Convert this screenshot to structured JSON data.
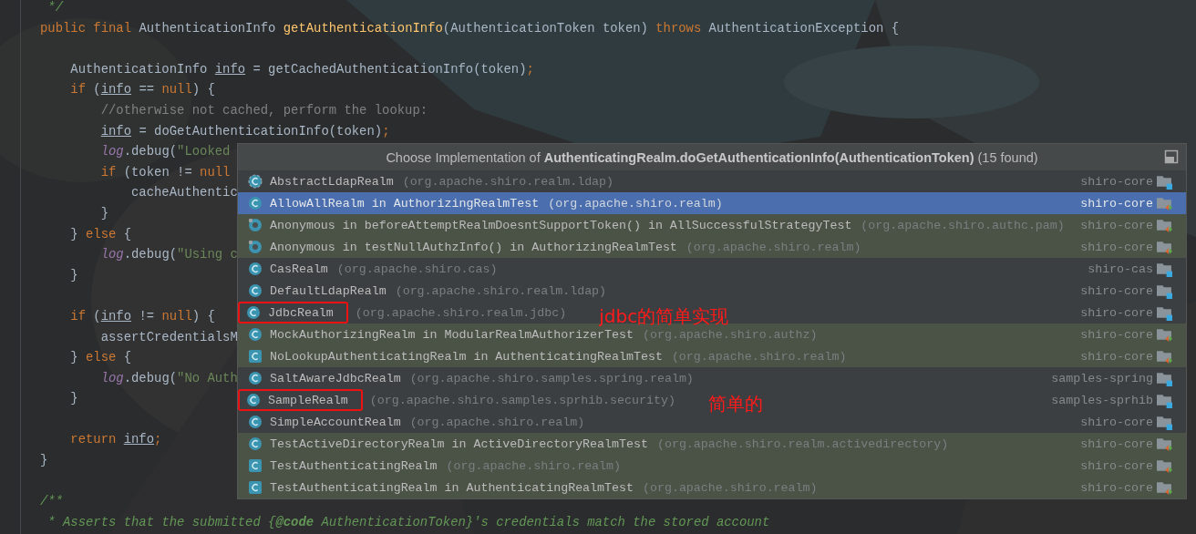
{
  "editor": {
    "lines": [
      {
        "segments": [
          {
            "kind": "doc",
            "text": " */"
          }
        ]
      },
      {
        "segments": [
          {
            "kind": "kw",
            "text": "public final "
          },
          {
            "kind": "plain",
            "text": "AuthenticationInfo "
          },
          {
            "kind": "fn",
            "text": "getAuthenticationInfo"
          },
          {
            "kind": "plain",
            "text": "(AuthenticationToken token) "
          },
          {
            "kind": "kw",
            "text": "throws "
          },
          {
            "kind": "plain",
            "text": "AuthenticationException {"
          }
        ]
      },
      {
        "kind": "blank"
      },
      {
        "segments": [
          {
            "kind": "plain",
            "text": "    AuthenticationInfo "
          },
          {
            "kind": "var",
            "text": "info"
          },
          {
            "kind": "plain",
            "text": " = getCachedAuthenticationInfo(token)"
          },
          {
            "kind": "kw",
            "text": ";"
          }
        ]
      },
      {
        "segments": [
          {
            "kind": "kw",
            "text": "    if "
          },
          {
            "kind": "plain",
            "text": "("
          },
          {
            "kind": "var",
            "text": "info"
          },
          {
            "kind": "plain",
            "text": " == "
          },
          {
            "kind": "kw",
            "text": "null"
          },
          {
            "kind": "plain",
            "text": ") {"
          }
        ]
      },
      {
        "segments": [
          {
            "kind": "comment",
            "text": "        //otherwise not cached, perform the lookup:"
          }
        ]
      },
      {
        "segments": [
          {
            "kind": "var",
            "text": "        info"
          },
          {
            "kind": "plain",
            "text": " = doGetAuthenticationInfo(token)"
          },
          {
            "kind": "kw",
            "text": ";"
          }
        ]
      },
      {
        "segments": [
          {
            "kind": "field",
            "text": "        log"
          },
          {
            "kind": "plain",
            "text": ".debug("
          },
          {
            "kind": "str",
            "text": "\"Looked"
          }
        ]
      },
      {
        "segments": [
          {
            "kind": "kw",
            "text": "        if "
          },
          {
            "kind": "plain",
            "text": "(token != "
          },
          {
            "kind": "kw",
            "text": "null"
          }
        ]
      },
      {
        "segments": [
          {
            "kind": "plain",
            "text": "            cacheAuthentic"
          }
        ]
      },
      {
        "segments": [
          {
            "kind": "plain",
            "text": "        }"
          }
        ]
      },
      {
        "segments": [
          {
            "kind": "plain",
            "text": "    } "
          },
          {
            "kind": "kw",
            "text": "else"
          },
          {
            "kind": "plain",
            "text": " {"
          }
        ]
      },
      {
        "segments": [
          {
            "kind": "field",
            "text": "        log"
          },
          {
            "kind": "plain",
            "text": ".debug("
          },
          {
            "kind": "str",
            "text": "\"Using c"
          }
        ]
      },
      {
        "segments": [
          {
            "kind": "plain",
            "text": "    }"
          }
        ]
      },
      {
        "kind": "blank"
      },
      {
        "segments": [
          {
            "kind": "kw",
            "text": "    if "
          },
          {
            "kind": "plain",
            "text": "("
          },
          {
            "kind": "var",
            "text": "info"
          },
          {
            "kind": "plain",
            "text": " != "
          },
          {
            "kind": "kw",
            "text": "null"
          },
          {
            "kind": "plain",
            "text": ") {"
          }
        ]
      },
      {
        "segments": [
          {
            "kind": "plain",
            "text": "        assertCredentialsM"
          }
        ]
      },
      {
        "segments": [
          {
            "kind": "plain",
            "text": "    } "
          },
          {
            "kind": "kw",
            "text": "else"
          },
          {
            "kind": "plain",
            "text": " {"
          }
        ]
      },
      {
        "segments": [
          {
            "kind": "field",
            "text": "        log"
          },
          {
            "kind": "plain",
            "text": ".debug("
          },
          {
            "kind": "str",
            "text": "\"No Auth"
          }
        ]
      },
      {
        "segments": [
          {
            "kind": "plain",
            "text": "    }"
          }
        ]
      },
      {
        "kind": "blank"
      },
      {
        "segments": [
          {
            "kind": "kw",
            "text": "    return "
          },
          {
            "kind": "var",
            "text": "info"
          },
          {
            "kind": "kw",
            "text": ";"
          }
        ]
      },
      {
        "segments": [
          {
            "kind": "plain",
            "text": "}"
          }
        ]
      },
      {
        "kind": "blank"
      },
      {
        "segments": [
          {
            "kind": "doc",
            "text": "/**"
          }
        ]
      },
      {
        "segments": [
          {
            "kind": "doc",
            "text": " * Asserts that the submitted {**@code** AuthenticationToken}'s credentials match the stored account"
          }
        ]
      }
    ]
  },
  "popup": {
    "title": "Choose Implementation of **AuthenticatingRealm.doGetAuthenticationInfo(AuthenticationToken)** (15 found)",
    "rows": [
      {
        "kind": "abstract",
        "name": "AbstractLdapRealm",
        "package": "(org.apache.shiro.realm.ldap)",
        "module": "shiro-core",
        "test": false,
        "selected": false
      },
      {
        "kind": "class",
        "name": "AllowAllRealm in AuthorizingRealmTest",
        "package": "(org.apache.shiro.realm)",
        "module": "shiro-core",
        "test": true,
        "selected": true
      },
      {
        "kind": "anonymous",
        "name": "Anonymous in beforeAttemptRealmDoesntSupportToken() in AllSuccessfulStrategyTest",
        "package": "(org.apache.shiro.authc.pam)",
        "module": "shiro-core",
        "test": true,
        "selected": false
      },
      {
        "kind": "anonymous",
        "name": "Anonymous in testNullAuthzInfo() in AuthorizingRealmTest",
        "package": "(org.apache.shiro.realm)",
        "module": "shiro-core",
        "test": true,
        "selected": false
      },
      {
        "kind": "class",
        "name": "CasRealm",
        "package": "(org.apache.shiro.cas)",
        "module": "shiro-cas",
        "test": false,
        "selected": false
      },
      {
        "kind": "class",
        "name": "DefaultLdapRealm",
        "package": "(org.apache.shiro.realm.ldap)",
        "module": "shiro-core",
        "test": false,
        "selected": false
      },
      {
        "kind": "class",
        "name": "JdbcRealm",
        "package": "(org.apache.shiro.realm.jdbc)",
        "module": "shiro-core",
        "test": false,
        "selected": false,
        "circled": true,
        "note": "jdbc的简单实现"
      },
      {
        "kind": "class",
        "name": "MockAuthorizingRealm in ModularRealmAuthorizerTest",
        "package": "(org.apache.shiro.authz)",
        "module": "shiro-core",
        "test": true,
        "selected": false
      },
      {
        "kind": "square",
        "name": "NoLookupAuthenticatingRealm in AuthenticatingRealmTest",
        "package": "(org.apache.shiro.realm)",
        "module": "shiro-core",
        "test": true,
        "selected": false
      },
      {
        "kind": "class",
        "name": "SaltAwareJdbcRealm",
        "package": "(org.apache.shiro.samples.spring.realm)",
        "module": "samples-spring",
        "test": false,
        "selected": false
      },
      {
        "kind": "class",
        "name": "SampleRealm",
        "package": "(org.apache.shiro.samples.sprhib.security)",
        "module": "samples-sprhib",
        "test": false,
        "selected": false,
        "circled": true,
        "note": "简单的"
      },
      {
        "kind": "class",
        "name": "SimpleAccountRealm",
        "package": "(org.apache.shiro.realm)",
        "module": "shiro-core",
        "test": false,
        "selected": false
      },
      {
        "kind": "class",
        "name": "TestActiveDirectoryRealm in ActiveDirectoryRealmTest",
        "package": "(org.apache.shiro.realm.activedirectory)",
        "module": "shiro-core",
        "test": true,
        "selected": false
      },
      {
        "kind": "square",
        "name": "TestAuthenticatingRealm",
        "package": "(org.apache.shiro.realm)",
        "module": "shiro-core",
        "test": true,
        "selected": false
      },
      {
        "kind": "square",
        "name": "TestAuthenticatingRealm in AuthenticatingRealmTest",
        "package": "(org.apache.shiro.realm)",
        "module": "shiro-core",
        "test": true,
        "selected": false
      }
    ]
  }
}
